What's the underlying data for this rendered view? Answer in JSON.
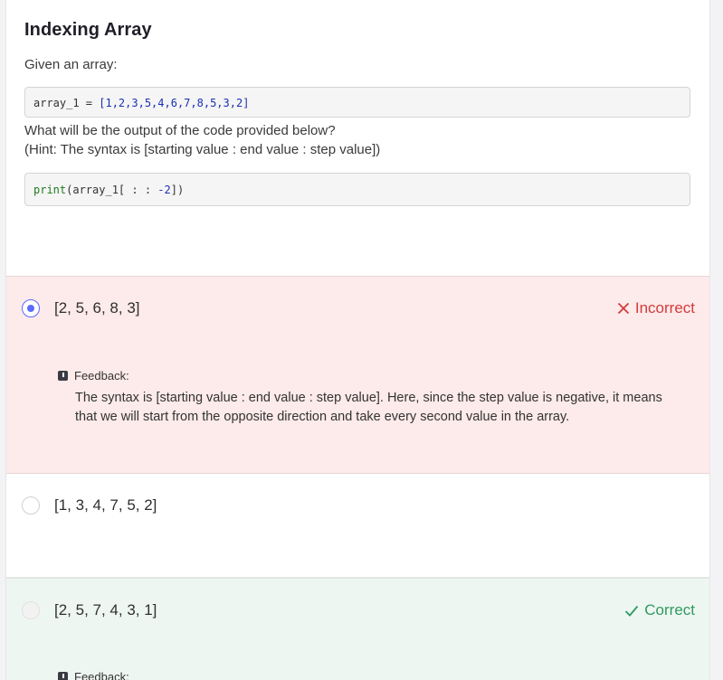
{
  "question": {
    "title": "Indexing Array",
    "intro": "Given an array:",
    "code1": {
      "var": "array_1 = ",
      "value": "[1,2,3,5,4,6,7,8,5,3,2]"
    },
    "prompt": "What will be the output of the code provided below?",
    "hint": "(Hint: The syntax is [starting value : end value : step value])",
    "code2": {
      "fn": "print",
      "open": "(array_1[ : : ",
      "num": "-2",
      "close": "])"
    }
  },
  "options": [
    {
      "label": "[2, 5, 6, 8, 3]",
      "selected": true,
      "status": "Incorrect",
      "feedback_title": "Feedback:",
      "feedback": "The syntax is [starting value : end value : step value]. Here, since the step value is negative, it means that we will start from the opposite direction and take every second value in the array."
    },
    {
      "label": "[1, 3, 4, 7, 5, 2]",
      "selected": false
    },
    {
      "label": "[2, 5, 7, 4, 3, 1]",
      "selected": false,
      "status": "Correct",
      "feedback_title": "Feedback:"
    }
  ],
  "colors": {
    "selected": "#5b6bff",
    "incorrect": "#d43b3b",
    "correct": "#2e9b5f",
    "incorrect_bg": "#fdeaea",
    "correct_bg": "#eef6f2"
  },
  "icons": {
    "feedback": "comment-icon",
    "incorrect": "x-icon",
    "correct": "check-icon"
  }
}
